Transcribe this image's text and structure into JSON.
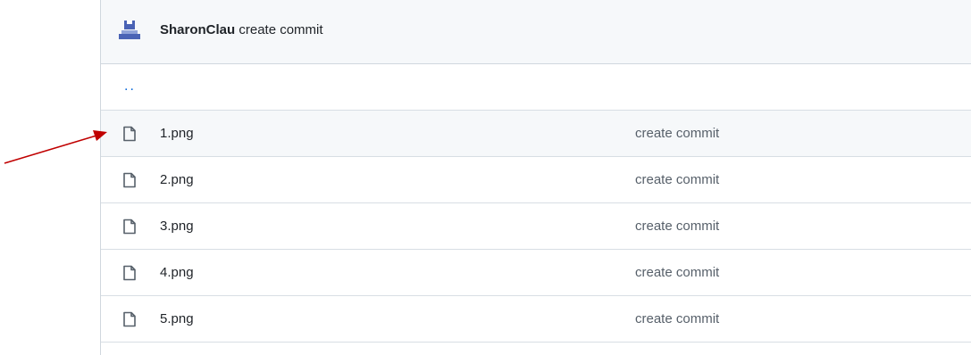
{
  "commit_header": {
    "author": "SharonClau",
    "message": "create commit"
  },
  "parent_dir": {
    "label": ".."
  },
  "files": [
    {
      "name": "1.png",
      "commit": "create commit",
      "icon": "file-icon"
    },
    {
      "name": "2.png",
      "commit": "create commit",
      "icon": "file-icon"
    },
    {
      "name": "3.png",
      "commit": "create commit",
      "icon": "file-icon"
    },
    {
      "name": "4.png",
      "commit": "create commit",
      "icon": "file-icon"
    },
    {
      "name": "5.png",
      "commit": "create commit",
      "icon": "file-icon"
    }
  ],
  "colors": {
    "link": "#0969da",
    "annotation_arrow": "#c00000",
    "avatar": "#4a63b5"
  }
}
